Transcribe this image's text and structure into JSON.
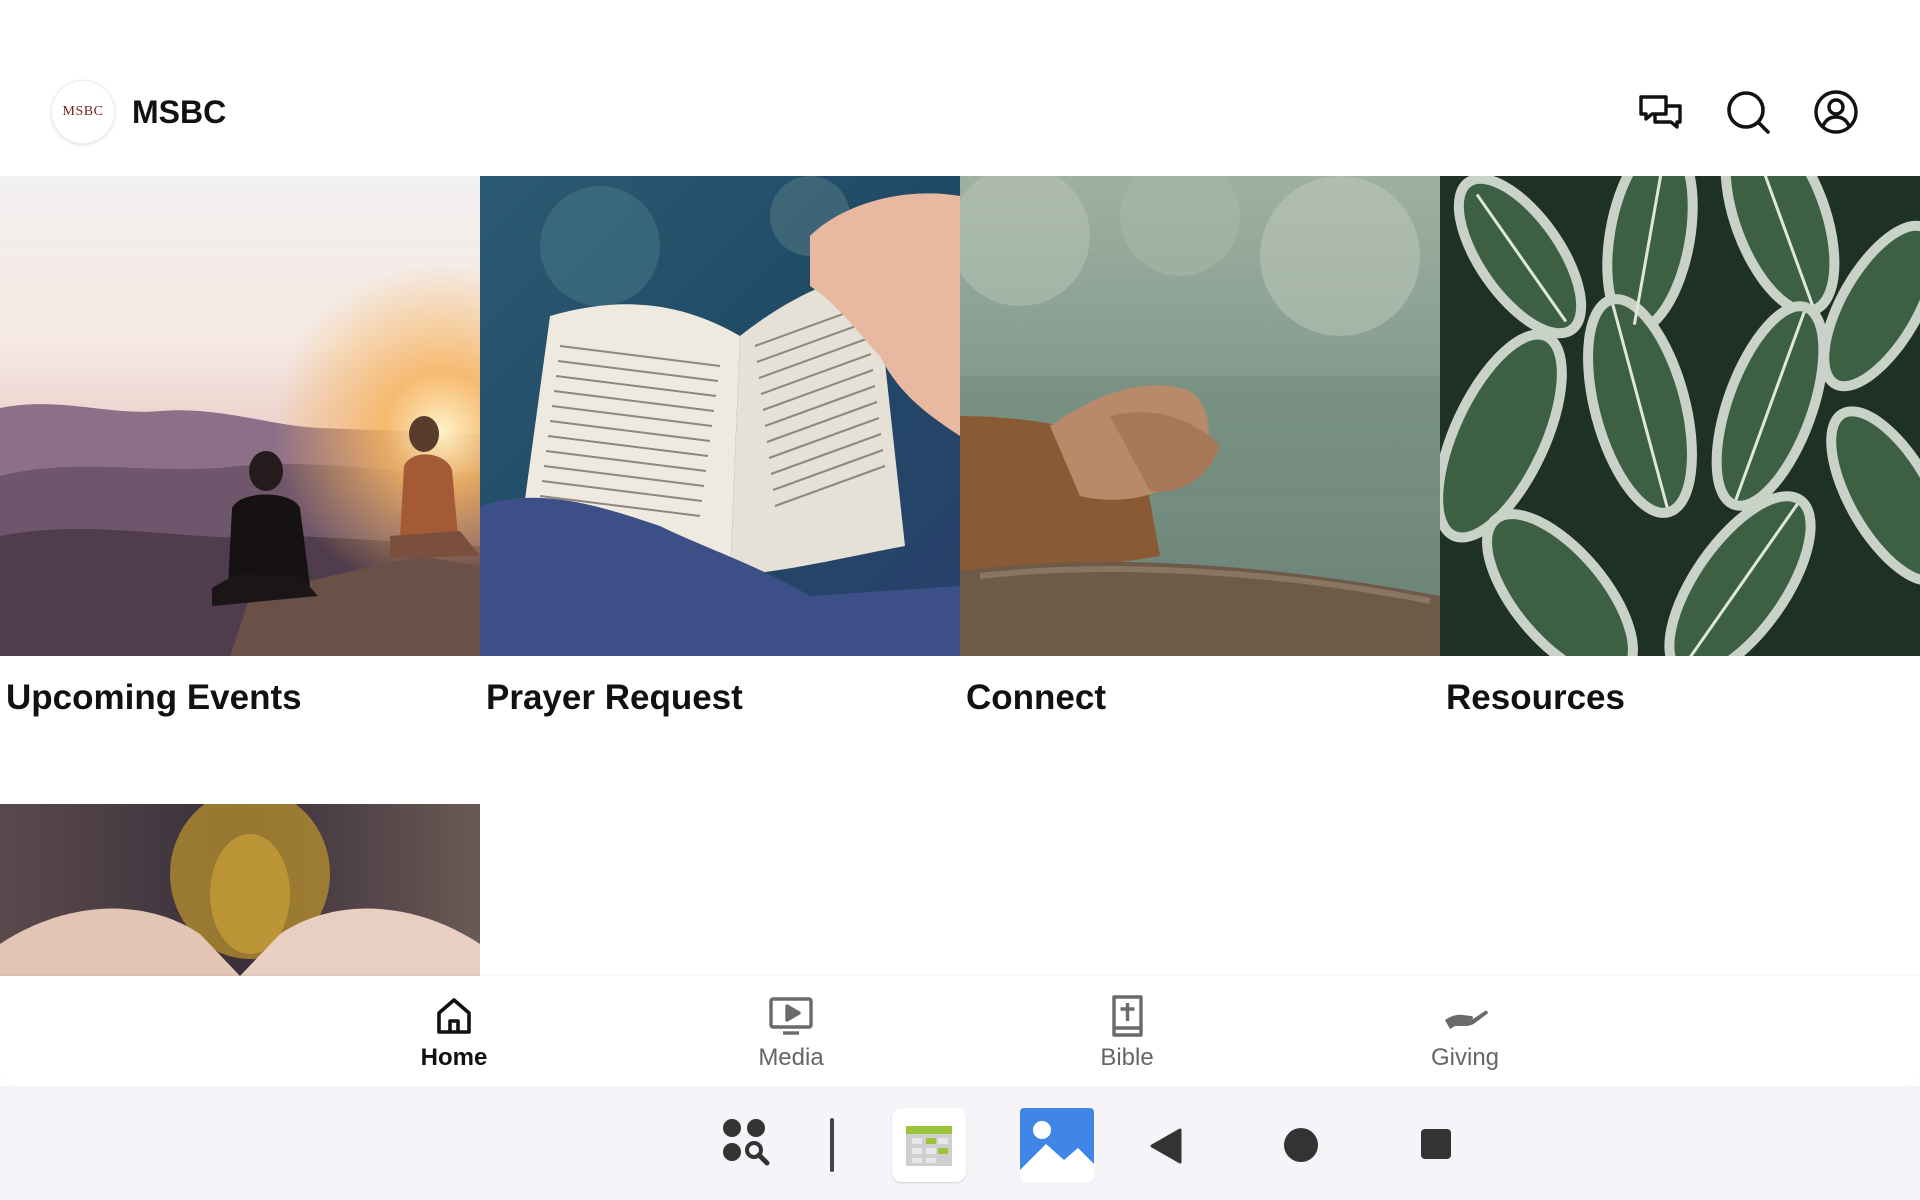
{
  "app": {
    "logo_text": "MSBC",
    "title": "MSBC"
  },
  "header_icons": [
    "chat-bubbles-icon",
    "search-icon",
    "account-circle-icon"
  ],
  "tiles": [
    {
      "label": "Upcoming Events",
      "image": "people-on-mountain-at-sunset"
    },
    {
      "label": "Prayer Request",
      "image": "hand-holding-open-bible"
    },
    {
      "label": "Connect",
      "image": "clasped-hands-on-railing-by-forest"
    },
    {
      "label": "Resources",
      "image": "green-variegated-leaves"
    },
    {
      "label": "",
      "image": "open-hands-blurred"
    }
  ],
  "bottom_nav": [
    {
      "label": "Home",
      "icon": "home-icon",
      "active": true
    },
    {
      "label": "Media",
      "icon": "tv-play-icon",
      "active": false
    },
    {
      "label": "Bible",
      "icon": "bible-icon",
      "active": false
    },
    {
      "label": "Giving",
      "icon": "giving-hand-icon",
      "active": false
    }
  ],
  "system_bar": [
    "apps-search-icon",
    "calendar-app-icon",
    "gallery-app-icon",
    "back-icon",
    "home-circle-icon",
    "recents-square-icon"
  ],
  "colors": {
    "accent_active": "#111111",
    "inactive": "#666666",
    "system_bar_bg": "#f6f4f9"
  }
}
